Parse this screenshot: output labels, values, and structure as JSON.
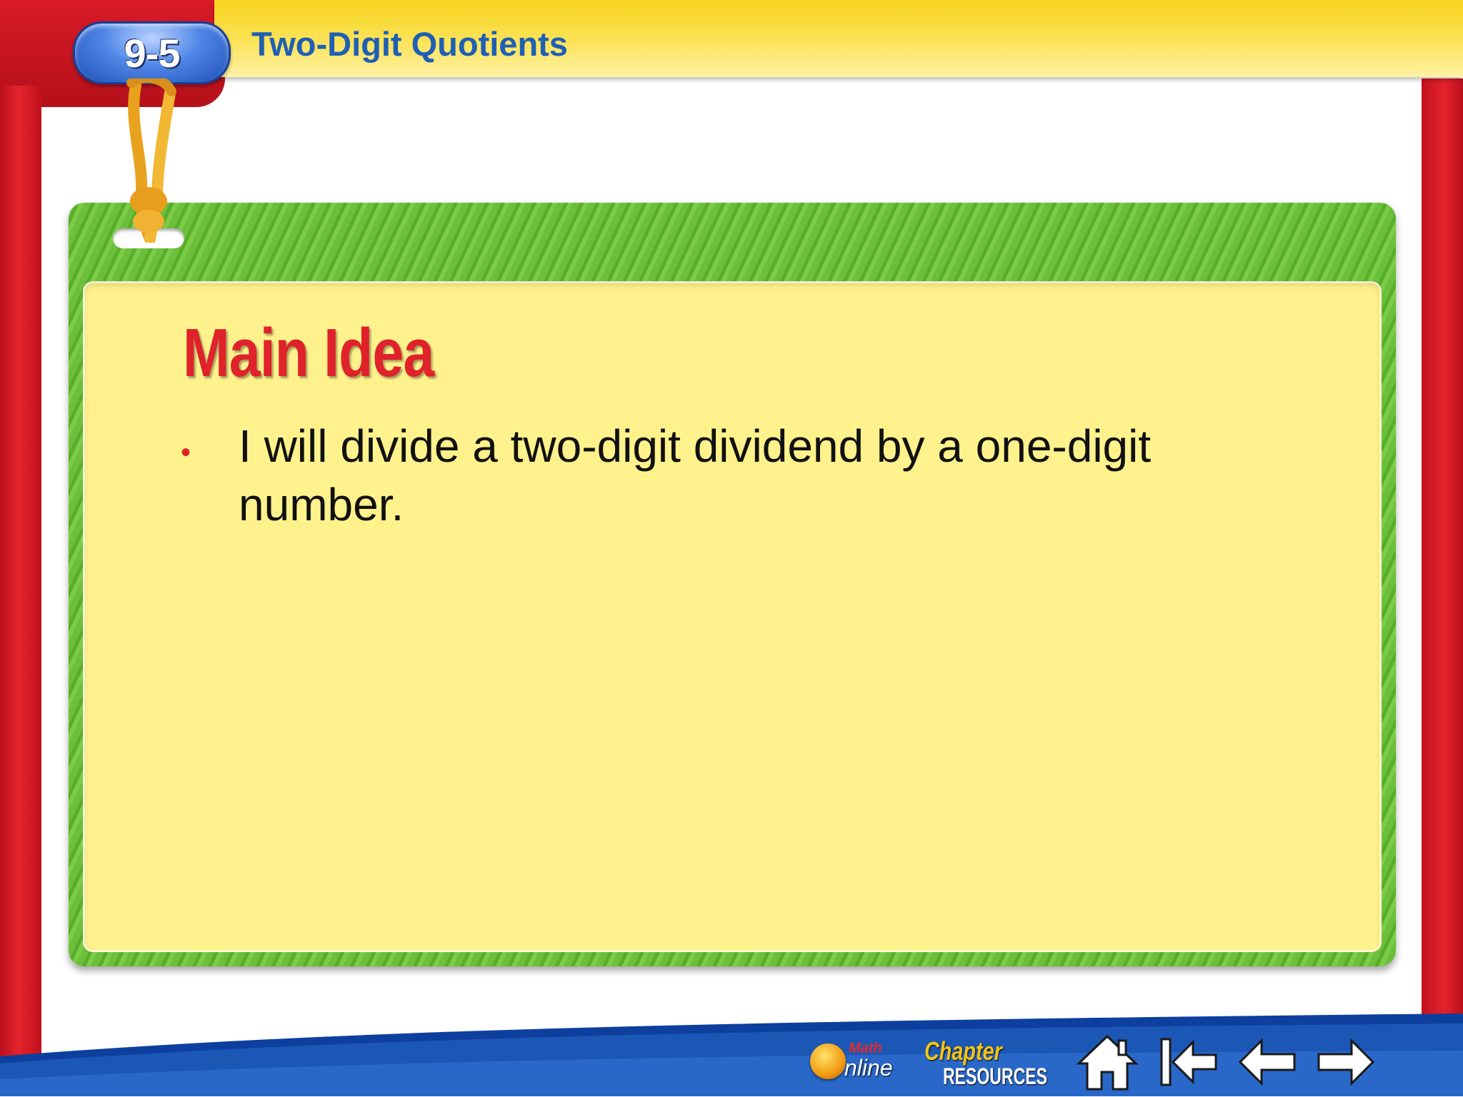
{
  "header": {
    "lesson_number": "9-5",
    "lesson_title": "Two-Digit Quotients"
  },
  "card": {
    "heading": "Main Idea",
    "bullet": "•",
    "text": "I will divide a two-digit dividend by a one-digit number."
  },
  "nav": {
    "math_online": {
      "math": "Math",
      "online": "nline"
    },
    "chapter_resources": {
      "chapter": "Chapter",
      "resources": "RESOURCES"
    },
    "icons": [
      "home-icon",
      "first-slide-icon",
      "previous-slide-icon",
      "next-slide-icon"
    ]
  },
  "colors": {
    "frame_red": "#e5222c",
    "top_bar_yellow": "#f6d41c",
    "title_blue": "#1f5fb4",
    "card_green": "#6cbf3a",
    "card_yellow": "#fff28c",
    "heading_red": "#e0222b",
    "nav_blue": "#1c57b6"
  }
}
